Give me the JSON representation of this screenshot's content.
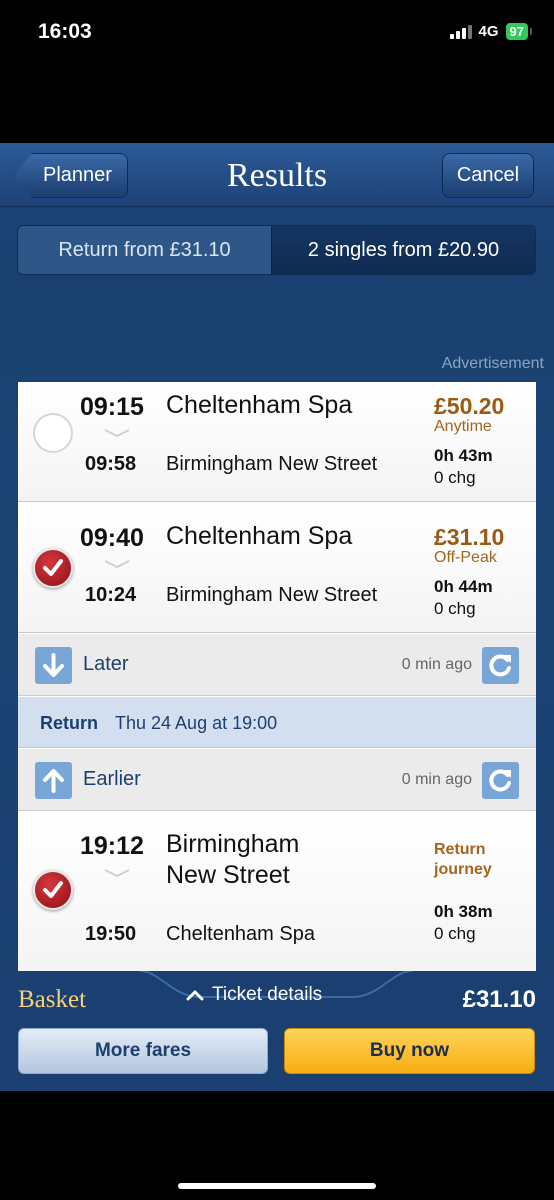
{
  "status_bar": {
    "time": "16:03",
    "network": "4G",
    "battery": "97"
  },
  "nav": {
    "back_label": "Planner",
    "title": "Results",
    "cancel_label": "Cancel"
  },
  "tabs": [
    {
      "label": "Return from £31.10",
      "selected": false
    },
    {
      "label": "2 singles from £20.90",
      "selected": true
    }
  ],
  "advertisement_label": "Advertisement",
  "outbound": [
    {
      "dep_time": "09:15",
      "from": "Cheltenham Spa",
      "arr_time": "09:58",
      "to": "Birmingham New Street",
      "price": "£50.20",
      "fare_type": "Anytime",
      "duration": "0h 43m",
      "changes": "0 chg",
      "selected": false
    },
    {
      "dep_time": "09:40",
      "from": "Cheltenham Spa",
      "arr_time": "10:24",
      "to": "Birmingham New Street",
      "price": "£31.10",
      "fare_type": "Off-Peak",
      "duration": "0h 44m",
      "changes": "0 chg",
      "selected": true
    }
  ],
  "later": {
    "label": "Later",
    "age": "0 min ago"
  },
  "return_banner": {
    "prefix": "Return",
    "datetime": "Thu 24 Aug at 19:00"
  },
  "earlier": {
    "label": "Earlier",
    "age": "0 min ago"
  },
  "return_journeys": [
    {
      "dep_time": "19:12",
      "from_line1": "Birmingham",
      "from_line2": "New Street",
      "arr_time": "19:50",
      "to": "Cheltenham Spa",
      "note_line1": "Return",
      "note_line2": "journey",
      "duration": "0h 38m",
      "changes": "0 chg",
      "selected": true
    }
  ],
  "basket": {
    "label": "Basket",
    "details_label": "Ticket details",
    "total": "£31.10",
    "more_fares": "More fares",
    "buy_now": "Buy now"
  },
  "colors": {
    "navy": "#1a3f70",
    "price_brown": "#9a5a14",
    "accent_blue": "#79a6d6",
    "buy_yellow": "#f6ae12",
    "check_red": "#b3161d"
  }
}
